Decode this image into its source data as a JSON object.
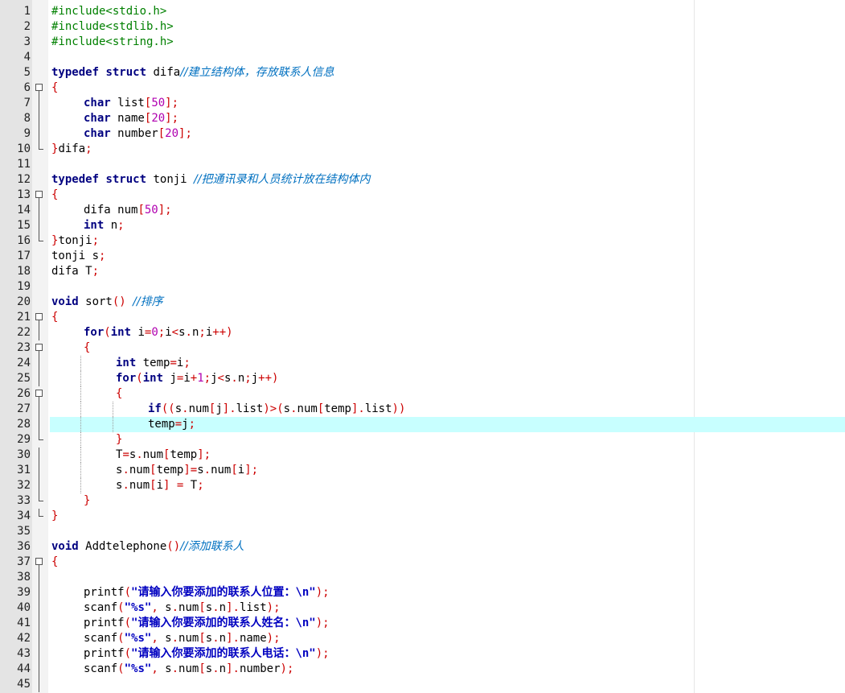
{
  "editor": {
    "colors": {
      "gutter_bg": "#e4e4e4",
      "current_line_bg": "#c8ffff",
      "preprocessor": "#008000",
      "keyword": "#000080",
      "operator": "#cc0000",
      "number": "#b000b0",
      "comment": "#0070c0",
      "string": "#0000c0"
    },
    "current_line": 28,
    "lines": [
      {
        "n": "1",
        "fold": "",
        "indent": 0,
        "tokens": [
          [
            "pre",
            "#include<stdio.h>"
          ]
        ]
      },
      {
        "n": "2",
        "fold": "",
        "indent": 0,
        "tokens": [
          [
            "pre",
            "#include<stdlib.h>"
          ]
        ]
      },
      {
        "n": "3",
        "fold": "",
        "indent": 0,
        "tokens": [
          [
            "pre",
            "#include<string.h>"
          ]
        ]
      },
      {
        "n": "4",
        "fold": "",
        "indent": 0,
        "tokens": []
      },
      {
        "n": "5",
        "fold": "",
        "indent": 0,
        "tokens": [
          [
            "kw",
            "typedef"
          ],
          [
            "id",
            " "
          ],
          [
            "kw",
            "struct"
          ],
          [
            "id",
            " difa"
          ],
          [
            "cmt",
            "//建立结构体，存放联系人信息"
          ]
        ]
      },
      {
        "n": "6",
        "fold": "box",
        "indent": 0,
        "tokens": [
          [
            "op",
            "{"
          ]
        ]
      },
      {
        "n": "7",
        "fold": "vline",
        "indent": 1,
        "tokens": [
          [
            "kw",
            "char"
          ],
          [
            "id",
            " list"
          ],
          [
            "op",
            "["
          ],
          [
            "num",
            "50"
          ],
          [
            "op",
            "];"
          ]
        ]
      },
      {
        "n": "8",
        "fold": "vline",
        "indent": 1,
        "tokens": [
          [
            "kw",
            "char"
          ],
          [
            "id",
            " name"
          ],
          [
            "op",
            "["
          ],
          [
            "num",
            "20"
          ],
          [
            "op",
            "];"
          ]
        ]
      },
      {
        "n": "9",
        "fold": "vline",
        "indent": 1,
        "tokens": [
          [
            "kw",
            "char"
          ],
          [
            "id",
            " number"
          ],
          [
            "op",
            "["
          ],
          [
            "num",
            "20"
          ],
          [
            "op",
            "];"
          ]
        ]
      },
      {
        "n": "10",
        "fold": "end",
        "indent": 0,
        "tokens": [
          [
            "op",
            "}"
          ],
          [
            "id",
            "difa"
          ],
          [
            "op",
            ";"
          ]
        ]
      },
      {
        "n": "11",
        "fold": "",
        "indent": 0,
        "tokens": []
      },
      {
        "n": "12",
        "fold": "",
        "indent": 0,
        "tokens": [
          [
            "kw",
            "typedef"
          ],
          [
            "id",
            " "
          ],
          [
            "kw",
            "struct"
          ],
          [
            "id",
            " tonji "
          ],
          [
            "cmt",
            "//把通讯录和人员统计放在结构体内"
          ]
        ]
      },
      {
        "n": "13",
        "fold": "box",
        "indent": 0,
        "tokens": [
          [
            "op",
            "{"
          ]
        ]
      },
      {
        "n": "14",
        "fold": "vline",
        "indent": 1,
        "tokens": [
          [
            "id",
            "difa num"
          ],
          [
            "op",
            "["
          ],
          [
            "num",
            "50"
          ],
          [
            "op",
            "];"
          ]
        ]
      },
      {
        "n": "15",
        "fold": "vline",
        "indent": 1,
        "tokens": [
          [
            "kw",
            "int"
          ],
          [
            "id",
            " n"
          ],
          [
            "op",
            ";"
          ]
        ]
      },
      {
        "n": "16",
        "fold": "end",
        "indent": 0,
        "tokens": [
          [
            "op",
            "}"
          ],
          [
            "id",
            "tonji"
          ],
          [
            "op",
            ";"
          ]
        ]
      },
      {
        "n": "17",
        "fold": "",
        "indent": 0,
        "tokens": [
          [
            "id",
            "tonji s"
          ],
          [
            "op",
            ";"
          ]
        ]
      },
      {
        "n": "18",
        "fold": "",
        "indent": 0,
        "tokens": [
          [
            "id",
            "difa T"
          ],
          [
            "op",
            ";"
          ]
        ]
      },
      {
        "n": "19",
        "fold": "",
        "indent": 0,
        "tokens": []
      },
      {
        "n": "20",
        "fold": "",
        "indent": 0,
        "tokens": [
          [
            "kw",
            "void"
          ],
          [
            "id",
            " sort"
          ],
          [
            "op",
            "()"
          ],
          [
            "id",
            " "
          ],
          [
            "cmt",
            "//排序"
          ]
        ]
      },
      {
        "n": "21",
        "fold": "box",
        "indent": 0,
        "tokens": [
          [
            "op",
            "{"
          ]
        ]
      },
      {
        "n": "22",
        "fold": "vline",
        "indent": 1,
        "tokens": [
          [
            "kw",
            "for"
          ],
          [
            "op",
            "("
          ],
          [
            "kw",
            "int"
          ],
          [
            "id",
            " i"
          ],
          [
            "op",
            "="
          ],
          [
            "num",
            "0"
          ],
          [
            "op",
            ";"
          ],
          [
            "id",
            "i"
          ],
          [
            "op",
            "<"
          ],
          [
            "id",
            "s"
          ],
          [
            "op",
            "."
          ],
          [
            "id",
            "n"
          ],
          [
            "op",
            ";"
          ],
          [
            "id",
            "i"
          ],
          [
            "op",
            "++)"
          ]
        ]
      },
      {
        "n": "23",
        "fold": "box",
        "indent": 1,
        "tokens": [
          [
            "op",
            "{"
          ]
        ]
      },
      {
        "n": "24",
        "fold": "vline",
        "indent": 2,
        "tokens": [
          [
            "kw",
            "int"
          ],
          [
            "id",
            " temp"
          ],
          [
            "op",
            "="
          ],
          [
            "id",
            "i"
          ],
          [
            "op",
            ";"
          ]
        ]
      },
      {
        "n": "25",
        "fold": "vline",
        "indent": 2,
        "tokens": [
          [
            "kw",
            "for"
          ],
          [
            "op",
            "("
          ],
          [
            "kw",
            "int"
          ],
          [
            "id",
            " j"
          ],
          [
            "op",
            "="
          ],
          [
            "id",
            "i"
          ],
          [
            "op",
            "+"
          ],
          [
            "num",
            "1"
          ],
          [
            "op",
            ";"
          ],
          [
            "id",
            "j"
          ],
          [
            "op",
            "<"
          ],
          [
            "id",
            "s"
          ],
          [
            "op",
            "."
          ],
          [
            "id",
            "n"
          ],
          [
            "op",
            ";"
          ],
          [
            "id",
            "j"
          ],
          [
            "op",
            "++)"
          ]
        ]
      },
      {
        "n": "26",
        "fold": "box",
        "indent": 2,
        "tokens": [
          [
            "op",
            "{"
          ]
        ]
      },
      {
        "n": "27",
        "fold": "vline",
        "indent": 3,
        "tokens": [
          [
            "kw",
            "if"
          ],
          [
            "op",
            "(("
          ],
          [
            "id",
            "s"
          ],
          [
            "op",
            "."
          ],
          [
            "id",
            "num"
          ],
          [
            "op",
            "["
          ],
          [
            "id",
            "j"
          ],
          [
            "op",
            "]."
          ],
          [
            "id",
            "list"
          ],
          [
            "op",
            ")>("
          ],
          [
            "id",
            "s"
          ],
          [
            "op",
            "."
          ],
          [
            "id",
            "num"
          ],
          [
            "op",
            "["
          ],
          [
            "id",
            "temp"
          ],
          [
            "op",
            "]."
          ],
          [
            "id",
            "list"
          ],
          [
            "op",
            "))"
          ]
        ]
      },
      {
        "n": "28",
        "fold": "vline",
        "indent": 3,
        "tokens": [
          [
            "id",
            "temp"
          ],
          [
            "op",
            "="
          ],
          [
            "id",
            "j"
          ],
          [
            "op",
            ";"
          ]
        ]
      },
      {
        "n": "29",
        "fold": "end",
        "indent": 2,
        "tokens": [
          [
            "op",
            "}"
          ]
        ]
      },
      {
        "n": "30",
        "fold": "vline",
        "indent": 2,
        "tokens": [
          [
            "id",
            "T"
          ],
          [
            "op",
            "="
          ],
          [
            "id",
            "s"
          ],
          [
            "op",
            "."
          ],
          [
            "id",
            "num"
          ],
          [
            "op",
            "["
          ],
          [
            "id",
            "temp"
          ],
          [
            "op",
            "];"
          ]
        ]
      },
      {
        "n": "31",
        "fold": "vline",
        "indent": 2,
        "tokens": [
          [
            "id",
            "s"
          ],
          [
            "op",
            "."
          ],
          [
            "id",
            "num"
          ],
          [
            "op",
            "["
          ],
          [
            "id",
            "temp"
          ],
          [
            "op",
            "]="
          ],
          [
            "id",
            "s"
          ],
          [
            "op",
            "."
          ],
          [
            "id",
            "num"
          ],
          [
            "op",
            "["
          ],
          [
            "id",
            "i"
          ],
          [
            "op",
            "];"
          ]
        ]
      },
      {
        "n": "32",
        "fold": "vline",
        "indent": 2,
        "tokens": [
          [
            "id",
            "s"
          ],
          [
            "op",
            "."
          ],
          [
            "id",
            "num"
          ],
          [
            "op",
            "["
          ],
          [
            "id",
            "i"
          ],
          [
            "op",
            "]"
          ],
          [
            "id",
            " "
          ],
          [
            "op",
            "="
          ],
          [
            "id",
            " T"
          ],
          [
            "op",
            ";"
          ]
        ]
      },
      {
        "n": "33",
        "fold": "end",
        "indent": 1,
        "tokens": [
          [
            "op",
            "}"
          ]
        ]
      },
      {
        "n": "34",
        "fold": "end",
        "indent": 0,
        "tokens": [
          [
            "op",
            "}"
          ]
        ]
      },
      {
        "n": "35",
        "fold": "",
        "indent": 0,
        "tokens": []
      },
      {
        "n": "36",
        "fold": "",
        "indent": 0,
        "tokens": [
          [
            "kw",
            "void"
          ],
          [
            "id",
            " Addtelephone"
          ],
          [
            "op",
            "()"
          ],
          [
            "cmt",
            "//添加联系人"
          ]
        ]
      },
      {
        "n": "37",
        "fold": "box",
        "indent": 0,
        "tokens": [
          [
            "op",
            "{"
          ]
        ]
      },
      {
        "n": "38",
        "fold": "vline",
        "indent": 0,
        "tokens": []
      },
      {
        "n": "39",
        "fold": "vline",
        "indent": 1,
        "tokens": [
          [
            "id",
            "printf"
          ],
          [
            "op",
            "("
          ],
          [
            "str",
            "\"请输入你要添加的联系人位置：\\n\""
          ],
          [
            "op",
            ");"
          ]
        ]
      },
      {
        "n": "40",
        "fold": "vline",
        "indent": 1,
        "tokens": [
          [
            "id",
            "scanf"
          ],
          [
            "op",
            "("
          ],
          [
            "str",
            "\"%s\""
          ],
          [
            "op",
            ","
          ],
          [
            "id",
            " s"
          ],
          [
            "op",
            "."
          ],
          [
            "id",
            "num"
          ],
          [
            "op",
            "["
          ],
          [
            "id",
            "s"
          ],
          [
            "op",
            "."
          ],
          [
            "id",
            "n"
          ],
          [
            "op",
            "]."
          ],
          [
            "id",
            "list"
          ],
          [
            "op",
            ");"
          ]
        ]
      },
      {
        "n": "41",
        "fold": "vline",
        "indent": 1,
        "tokens": [
          [
            "id",
            "printf"
          ],
          [
            "op",
            "("
          ],
          [
            "str",
            "\"请输入你要添加的联系人姓名：\\n\""
          ],
          [
            "op",
            ");"
          ]
        ]
      },
      {
        "n": "42",
        "fold": "vline",
        "indent": 1,
        "tokens": [
          [
            "id",
            "scanf"
          ],
          [
            "op",
            "("
          ],
          [
            "str",
            "\"%s\""
          ],
          [
            "op",
            ","
          ],
          [
            "id",
            " s"
          ],
          [
            "op",
            "."
          ],
          [
            "id",
            "num"
          ],
          [
            "op",
            "["
          ],
          [
            "id",
            "s"
          ],
          [
            "op",
            "."
          ],
          [
            "id",
            "n"
          ],
          [
            "op",
            "]."
          ],
          [
            "id",
            "name"
          ],
          [
            "op",
            ");"
          ]
        ]
      },
      {
        "n": "43",
        "fold": "vline",
        "indent": 1,
        "tokens": [
          [
            "id",
            "printf"
          ],
          [
            "op",
            "("
          ],
          [
            "str",
            "\"请输入你要添加的联系人电话：\\n\""
          ],
          [
            "op",
            ");"
          ]
        ]
      },
      {
        "n": "44",
        "fold": "vline",
        "indent": 1,
        "tokens": [
          [
            "id",
            "scanf"
          ],
          [
            "op",
            "("
          ],
          [
            "str",
            "\"%s\""
          ],
          [
            "op",
            ","
          ],
          [
            "id",
            " s"
          ],
          [
            "op",
            "."
          ],
          [
            "id",
            "num"
          ],
          [
            "op",
            "["
          ],
          [
            "id",
            "s"
          ],
          [
            "op",
            "."
          ],
          [
            "id",
            "n"
          ],
          [
            "op",
            "]."
          ],
          [
            "id",
            "number"
          ],
          [
            "op",
            ");"
          ]
        ]
      },
      {
        "n": "45",
        "fold": "vline",
        "indent": 0,
        "tokens": []
      }
    ]
  }
}
